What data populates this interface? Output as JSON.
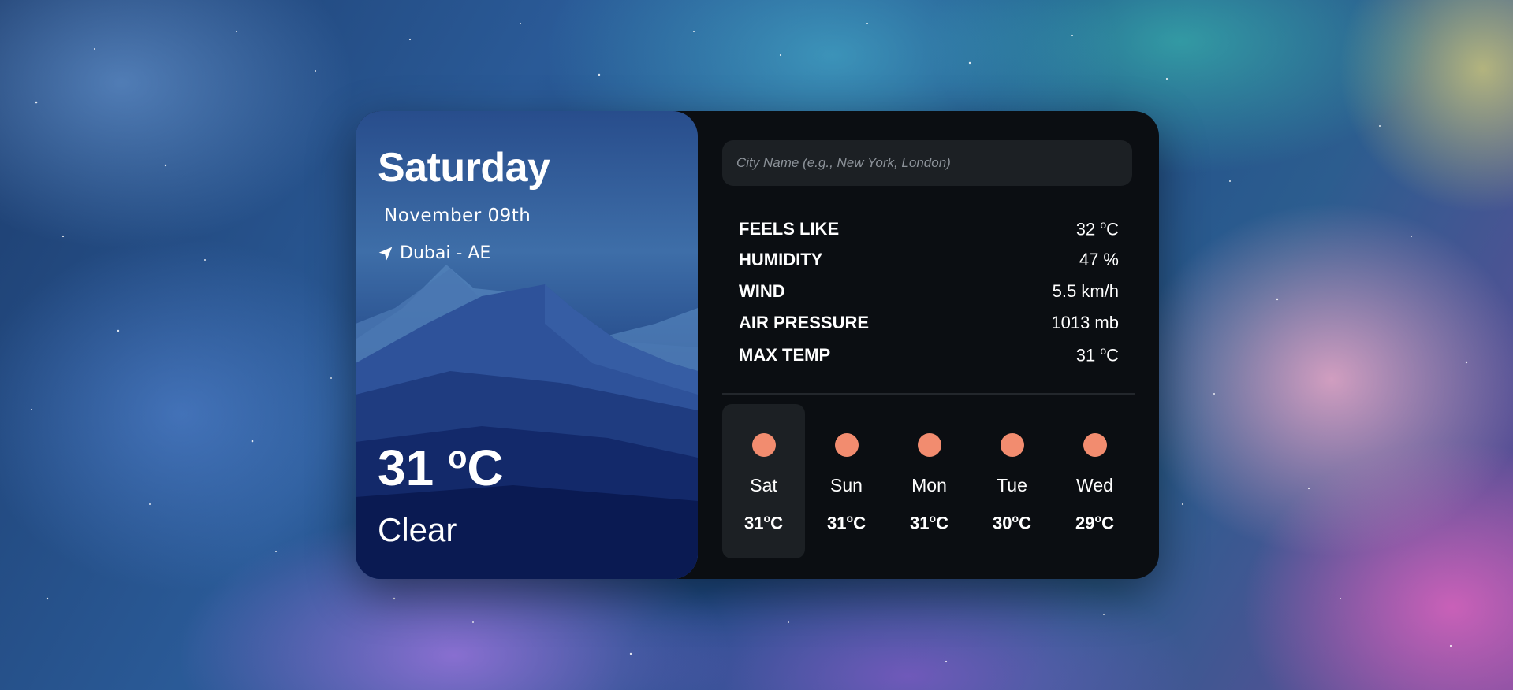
{
  "current": {
    "day": "Saturday",
    "date": "November 09th",
    "location": "Dubai - AE",
    "temp": "31",
    "unit": "C",
    "condition": "Clear"
  },
  "search": {
    "placeholder": "City Name (e.g., New York, London)"
  },
  "stats": [
    {
      "label": "FEELS LIKE",
      "value": "32 ",
      "unit": "C"
    },
    {
      "label": "HUMIDITY",
      "value": "47 %",
      "unit": ""
    },
    {
      "label": "WIND",
      "value": "5.5 km/h",
      "unit": ""
    },
    {
      "label": "AIR PRESSURE",
      "value": "1013 mb",
      "unit": ""
    },
    {
      "label": "MAX TEMP",
      "value": "31 ",
      "unit": "C"
    }
  ],
  "forecast": [
    {
      "day": "Sat",
      "temp": "31",
      "unit": "C",
      "icon": "sun-icon"
    },
    {
      "day": "Sun",
      "temp": "31",
      "unit": "C",
      "icon": "sun-icon"
    },
    {
      "day": "Mon",
      "temp": "31",
      "unit": "C",
      "icon": "sun-icon"
    },
    {
      "day": "Tue",
      "temp": "30",
      "unit": "C",
      "icon": "sun-icon"
    },
    {
      "day": "Wed",
      "temp": "29",
      "unit": "C",
      "icon": "sun-icon"
    }
  ],
  "colors": {
    "sun": "#f28c6f",
    "card": "#0b0e12",
    "search_bg": "#1c2024"
  }
}
